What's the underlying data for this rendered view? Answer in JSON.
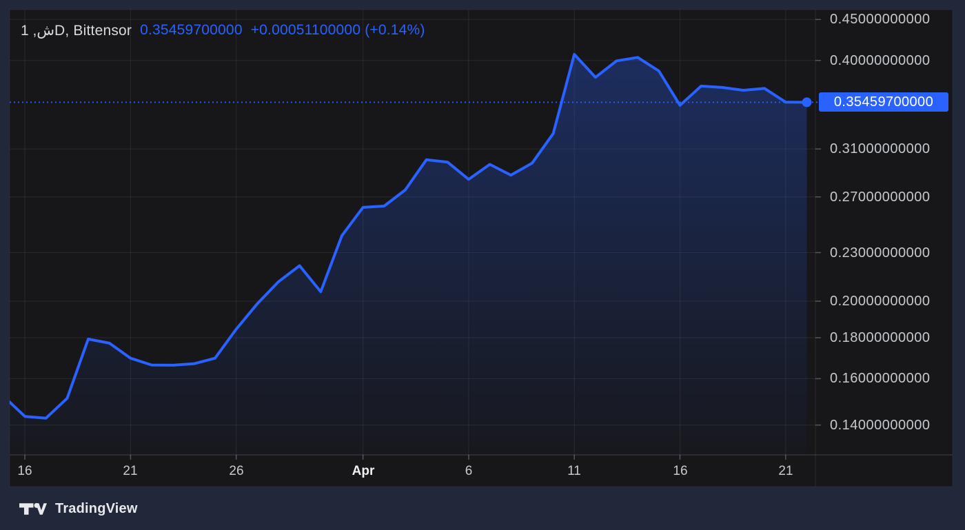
{
  "header": {
    "symbol_title": "ش, 1D, Bittensor",
    "price": "0.35459700000",
    "change": "+0.00051100000 (+0.14%)"
  },
  "price_scale": {
    "current_label": "0.35459700000",
    "ticks": [
      {
        "text": "0.45000000000",
        "value": 0.45
      },
      {
        "text": "0.40000000000",
        "value": 0.4
      },
      {
        "text": "0.31000000000",
        "value": 0.31
      },
      {
        "text": "0.27000000000",
        "value": 0.27
      },
      {
        "text": "0.23000000000",
        "value": 0.23
      },
      {
        "text": "0.20000000000",
        "value": 0.2
      },
      {
        "text": "0.18000000000",
        "value": 0.18
      },
      {
        "text": "0.16000000000",
        "value": 0.16
      },
      {
        "text": "0.14000000000",
        "value": 0.14
      }
    ]
  },
  "time_scale": {
    "ticks": [
      {
        "text": "16",
        "day_index": 1,
        "bold": false
      },
      {
        "text": "21",
        "day_index": 6,
        "bold": false
      },
      {
        "text": "26",
        "day_index": 11,
        "bold": false
      },
      {
        "text": "Apr",
        "day_index": 17,
        "bold": true
      },
      {
        "text": "6",
        "day_index": 22,
        "bold": false
      },
      {
        "text": "11",
        "day_index": 27,
        "bold": false
      },
      {
        "text": "16",
        "day_index": 32,
        "bold": false
      },
      {
        "text": "21",
        "day_index": 37,
        "bold": false
      }
    ]
  },
  "footer": {
    "brand": "TradingView"
  },
  "colors": {
    "accent_blue": "#2962ff",
    "outer_background": "#212839",
    "chart_background": "#17171a",
    "grid": "rgba(255,255,255,0.08)",
    "axis_text": "#c6c9ce",
    "bold_axis_text": "#eef0f2",
    "legend_text": "#d6d9de",
    "price_tag_text": "#ffffff"
  },
  "chart_data": {
    "type": "area",
    "name": "Bittensor",
    "interval": "1D",
    "yscale": "log",
    "grid": "on",
    "line_color": "#2962ff",
    "last_price": 0.354597,
    "change": "+0.00051100000",
    "change_pct": "+0.14%",
    "y_ticks": [
      0.45,
      0.4,
      0.31,
      0.27,
      0.23,
      0.2,
      0.18,
      0.16,
      0.14
    ],
    "x": [
      "Mar 15",
      "Mar 16",
      "Mar 17",
      "Mar 18",
      "Mar 19",
      "Mar 20",
      "Mar 21",
      "Mar 22",
      "Mar 23",
      "Mar 24",
      "Mar 25",
      "Mar 26",
      "Mar 27",
      "Mar 28",
      "Mar 29",
      "Mar 30",
      "Mar 31",
      "Apr 1",
      "Apr 2",
      "Apr 3",
      "Apr 4",
      "Apr 5",
      "Apr 6",
      "Apr 7",
      "Apr 8",
      "Apr 9",
      "Apr 10",
      "Apr 11",
      "Apr 12",
      "Apr 13",
      "Apr 14",
      "Apr 15",
      "Apr 16",
      "Apr 17",
      "Apr 18",
      "Apr 19",
      "Apr 20",
      "Apr 21",
      "Apr 22"
    ],
    "values": [
      0.152,
      0.1435,
      0.1428,
      0.1512,
      0.1793,
      0.1772,
      0.1697,
      0.1664,
      0.1663,
      0.167,
      0.1697,
      0.1845,
      0.1985,
      0.2115,
      0.2215,
      0.2055,
      0.2415,
      0.262,
      0.263,
      0.2755,
      0.3005,
      0.2985,
      0.284,
      0.2965,
      0.2875,
      0.2975,
      0.324,
      0.407,
      0.381,
      0.3995,
      0.4035,
      0.388,
      0.3515,
      0.3715,
      0.37,
      0.367,
      0.369,
      0.3547,
      0.354597
    ]
  }
}
